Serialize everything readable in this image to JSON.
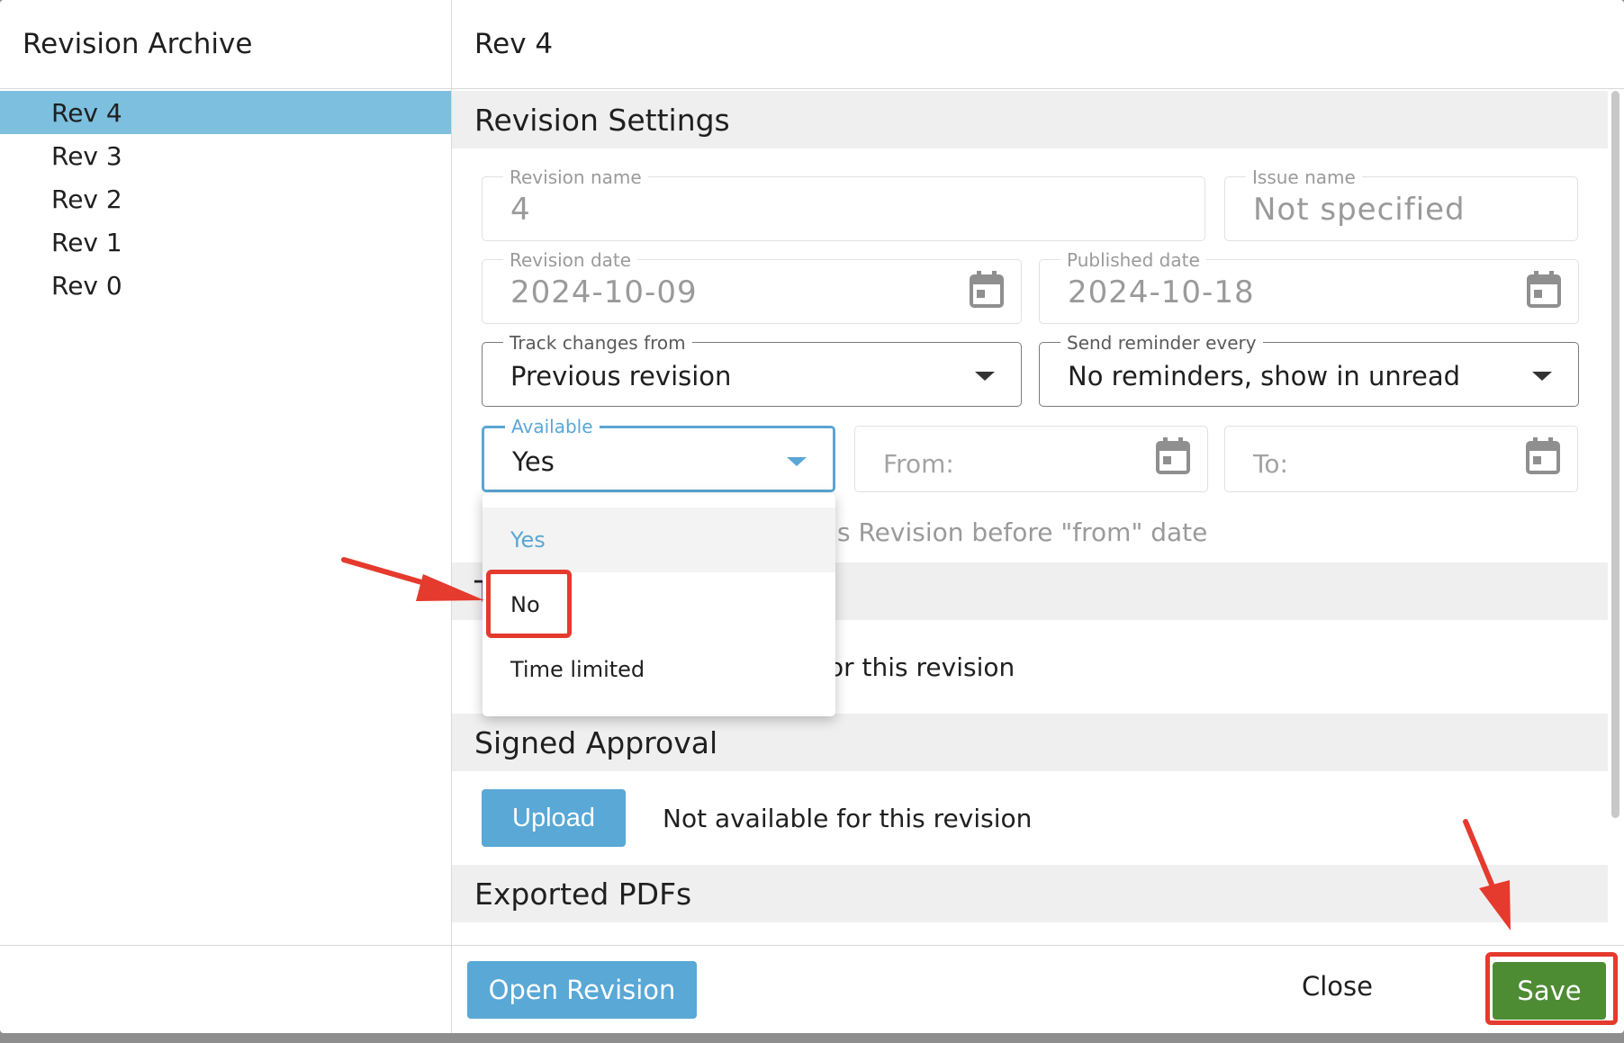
{
  "sidebar": {
    "title": "Revision Archive",
    "items": [
      {
        "label": "Rev 4",
        "active": true
      },
      {
        "label": "Rev 3"
      },
      {
        "label": "Rev 2"
      },
      {
        "label": "Rev 1"
      },
      {
        "label": "Rev 0"
      }
    ]
  },
  "main": {
    "title": "Rev 4",
    "settings": {
      "heading": "Revision Settings",
      "revision_name": {
        "label": "Revision name",
        "value": "4"
      },
      "issue_name": {
        "label": "Issue name",
        "value": "Not specified"
      },
      "revision_date": {
        "label": "Revision date",
        "value": "2024-10-09"
      },
      "published_date": {
        "label": "Published date",
        "value": "2024-10-18"
      },
      "track_changes": {
        "label": "Track changes from",
        "value": "Previous revision"
      },
      "reminder": {
        "label": "Send reminder every",
        "value": "No reminders, show in unread"
      },
      "available": {
        "label": "Available",
        "value": "Yes",
        "options": [
          "Yes",
          "No",
          "Time limited"
        ]
      },
      "from": {
        "placeholder": "From:"
      },
      "to": {
        "placeholder": "To:"
      },
      "helper_partial": "s Revision before \"from\" date"
    },
    "hidden_row_partial": "or this revision",
    "hidden_head_partial": "T",
    "signed_approval": {
      "heading": "Signed Approval",
      "upload_label": "Upload",
      "status": "Not available for this revision"
    },
    "exported_pdfs": {
      "heading": "Exported PDFs"
    }
  },
  "footer": {
    "open_label": "Open Revision",
    "close_label": "Close",
    "save_label": "Save"
  },
  "colors": {
    "accent": "#59a8d6",
    "selected_row": "#7dbfde",
    "save": "#4e8c34",
    "annotation": "#e53a2e"
  }
}
